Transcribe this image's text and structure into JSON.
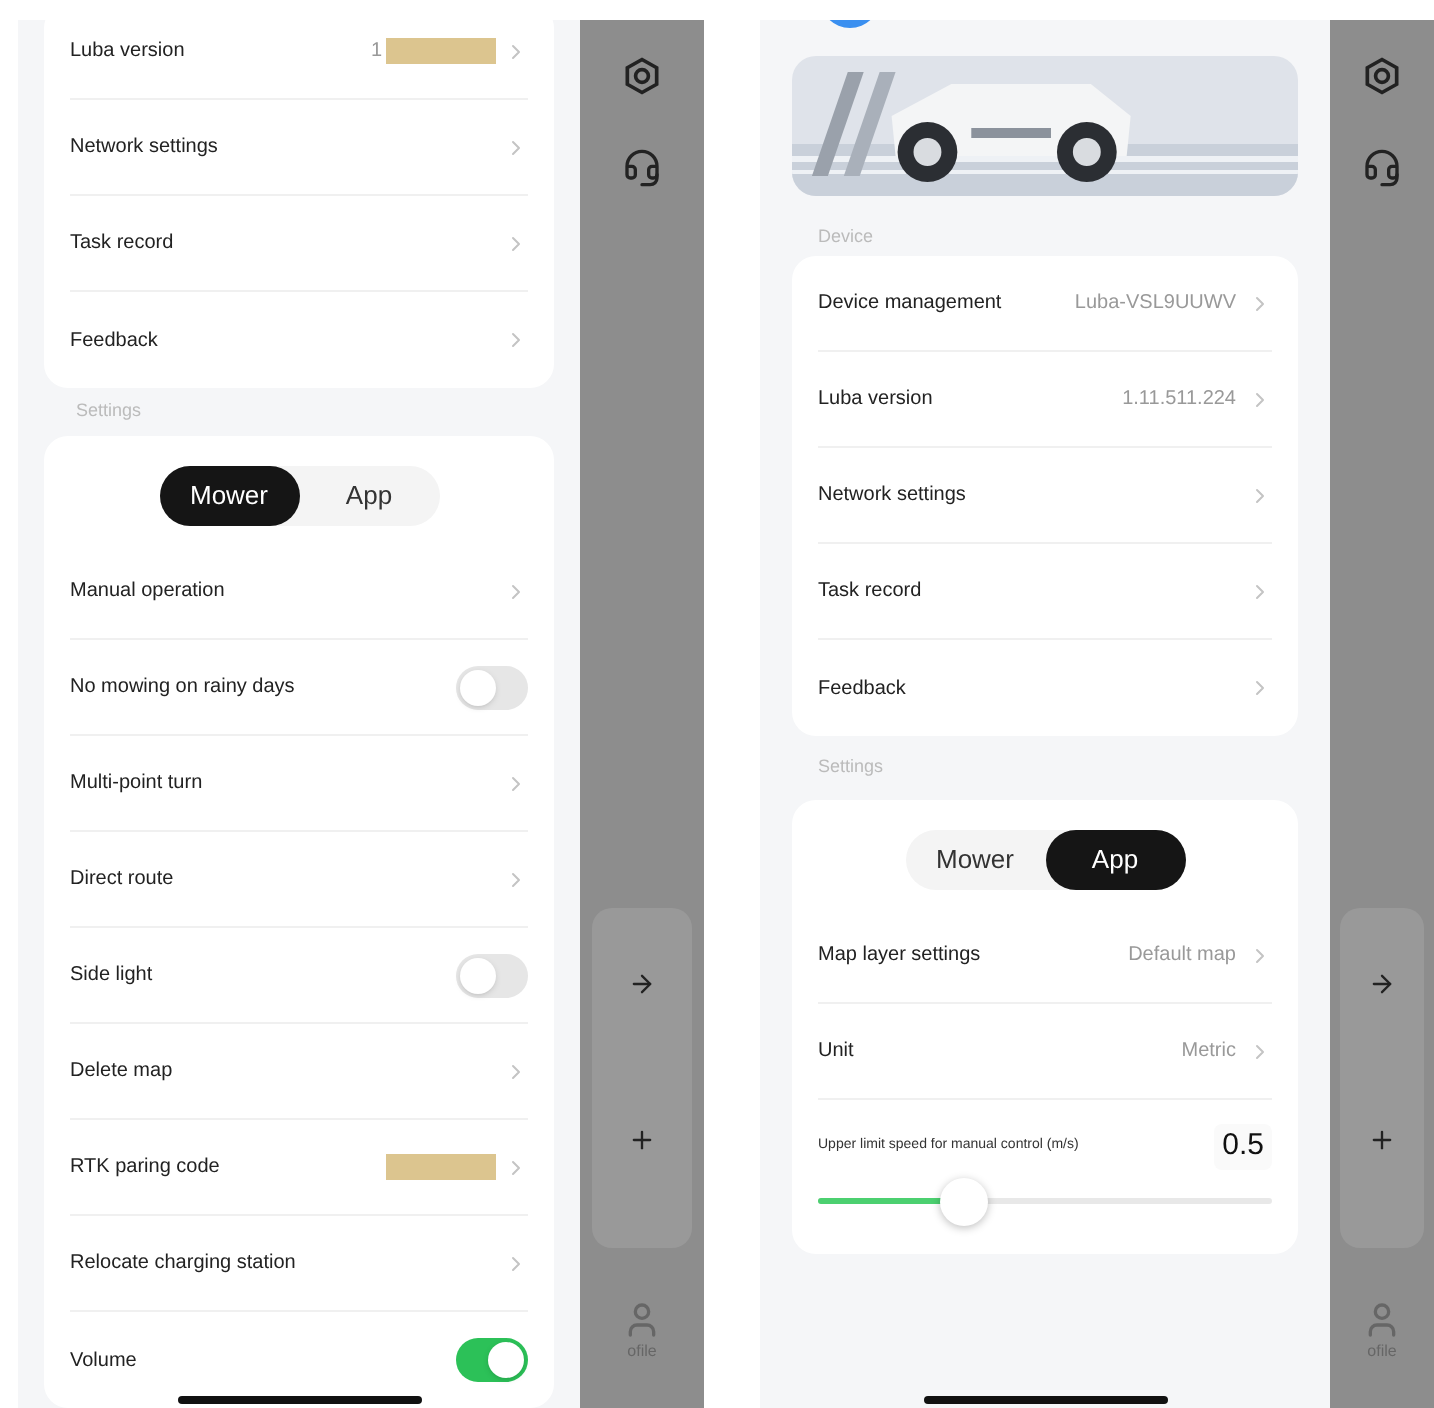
{
  "screens": [
    {
      "device": {
        "items": [
          {
            "kind": "link",
            "label": "Luba version",
            "value": "1",
            "redacted": true
          },
          {
            "kind": "link",
            "label": "Network settings"
          },
          {
            "kind": "link",
            "label": "Task record"
          },
          {
            "kind": "link",
            "label": "Feedback"
          }
        ]
      },
      "settings": {
        "label": "Settings",
        "segments": [
          {
            "label": "Mower",
            "selected": true
          },
          {
            "label": "App",
            "selected": false
          }
        ],
        "items": [
          {
            "kind": "link",
            "label": "Manual operation"
          },
          {
            "kind": "toggle",
            "label": "No mowing on rainy days",
            "on": false
          },
          {
            "kind": "link",
            "label": "Multi-point turn"
          },
          {
            "kind": "link",
            "label": "Direct route"
          },
          {
            "kind": "toggle",
            "label": "Side light",
            "on": false
          },
          {
            "kind": "link",
            "label": "Delete map"
          },
          {
            "kind": "link",
            "label": "RTK paring code",
            "redacted": true
          },
          {
            "kind": "link",
            "label": "Relocate charging station"
          },
          {
            "kind": "toggle",
            "label": "Volume",
            "on": true
          }
        ]
      },
      "backdrop": {
        "nav_label": "ofile"
      }
    },
    {
      "device": {
        "label": "Device",
        "items": [
          {
            "kind": "link",
            "label": "Device management",
            "value": "Luba-VSL9UUWV"
          },
          {
            "kind": "link",
            "label": "Luba version",
            "value": "1.11.511.224"
          },
          {
            "kind": "link",
            "label": "Network settings"
          },
          {
            "kind": "link",
            "label": "Task record"
          },
          {
            "kind": "link",
            "label": "Feedback"
          }
        ]
      },
      "settings": {
        "label": "Settings",
        "segments": [
          {
            "label": "Mower",
            "selected": false
          },
          {
            "label": "App",
            "selected": true
          }
        ],
        "items": [
          {
            "kind": "link",
            "label": "Map layer settings",
            "value": "Default map"
          },
          {
            "kind": "link",
            "label": "Unit",
            "value": "Metric"
          },
          {
            "kind": "slider",
            "label": "Upper limit speed for manual control (m/s)",
            "reading": "0.5",
            "level": 0.32
          }
        ]
      },
      "backdrop": {
        "nav_label": "ofile"
      }
    }
  ]
}
